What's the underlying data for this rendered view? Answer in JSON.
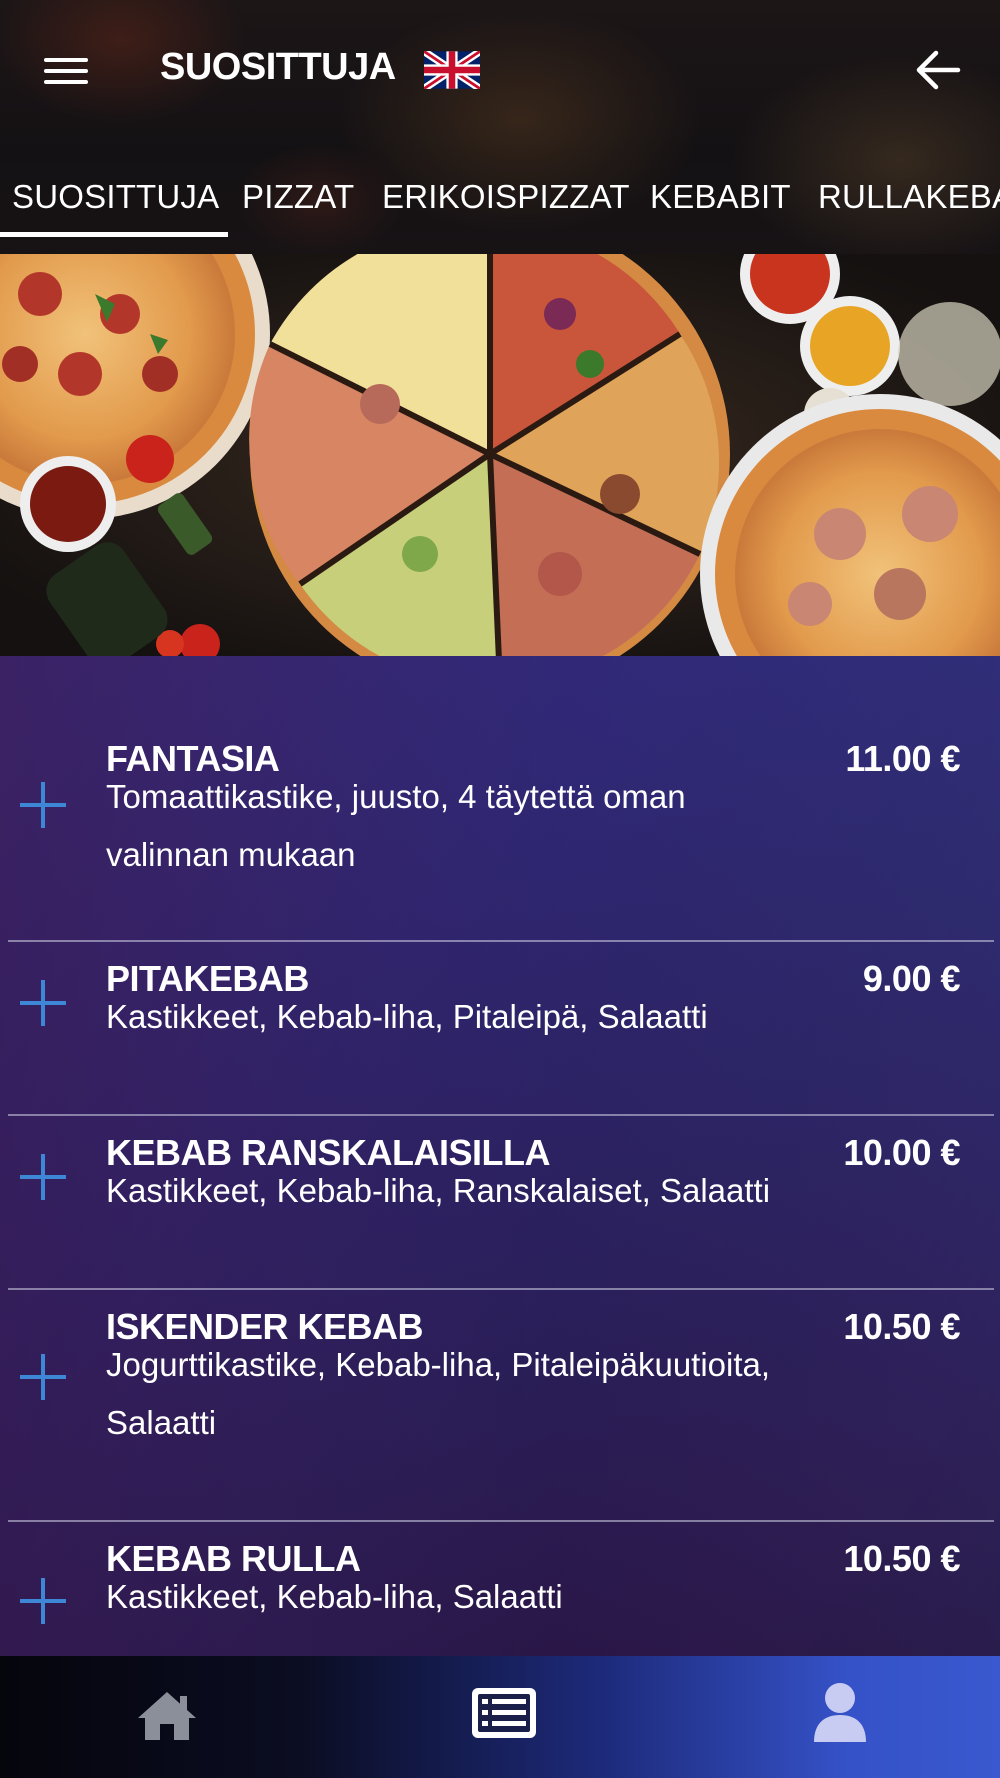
{
  "header": {
    "title": "SUOSITTUJA",
    "menu_icon": "hamburger-menu-icon",
    "language_icon": "uk-flag-icon",
    "back_icon": "arrow-left-icon"
  },
  "tabs": [
    {
      "label": "SUOSITTUJA",
      "active": true
    },
    {
      "label": "PIZZAT",
      "active": false
    },
    {
      "label": "ERIKOISPIZZAT",
      "active": false
    },
    {
      "label": "KEBABIT",
      "active": false
    },
    {
      "label": "RULLAKEBA",
      "active": false
    }
  ],
  "menu": {
    "items": [
      {
        "name": "FANTASIA",
        "price": "11.00 €",
        "description_lines": [
          "Tomaattikastike, juusto, 4 täytettä oman",
          "valinnan mukaan"
        ]
      },
      {
        "name": "PITAKEBAB",
        "price": "9.00 €",
        "description_lines": [
          "Kastikkeet, Kebab-liha, Pitaleipä, Salaatti"
        ]
      },
      {
        "name": "KEBAB RANSKALAISILLA",
        "price": "10.00 €",
        "description_lines": [
          "Kastikkeet, Kebab-liha, Ranskalaiset, Salaatti"
        ]
      },
      {
        "name": "ISKENDER KEBAB",
        "price": "10.50 €",
        "description_lines": [
          "Jogurttikastike, Kebab-liha, Pitaleipäkuutioita,",
          "Salaatti"
        ]
      },
      {
        "name": "KEBAB RULLA",
        "price": "10.50 €",
        "description_lines": [
          "Kastikkeet, Kebab-liha, Salaatti"
        ]
      }
    ]
  },
  "bottom_nav": {
    "items": [
      {
        "icon": "home-icon"
      },
      {
        "icon": "menu-list-icon"
      },
      {
        "icon": "user-profile-icon"
      }
    ]
  },
  "colors": {
    "accent_plus": "#3e86d6",
    "nav_right": "#3a58cf",
    "list_top": "#3a2f86",
    "list_bottom": "#230c2a"
  }
}
